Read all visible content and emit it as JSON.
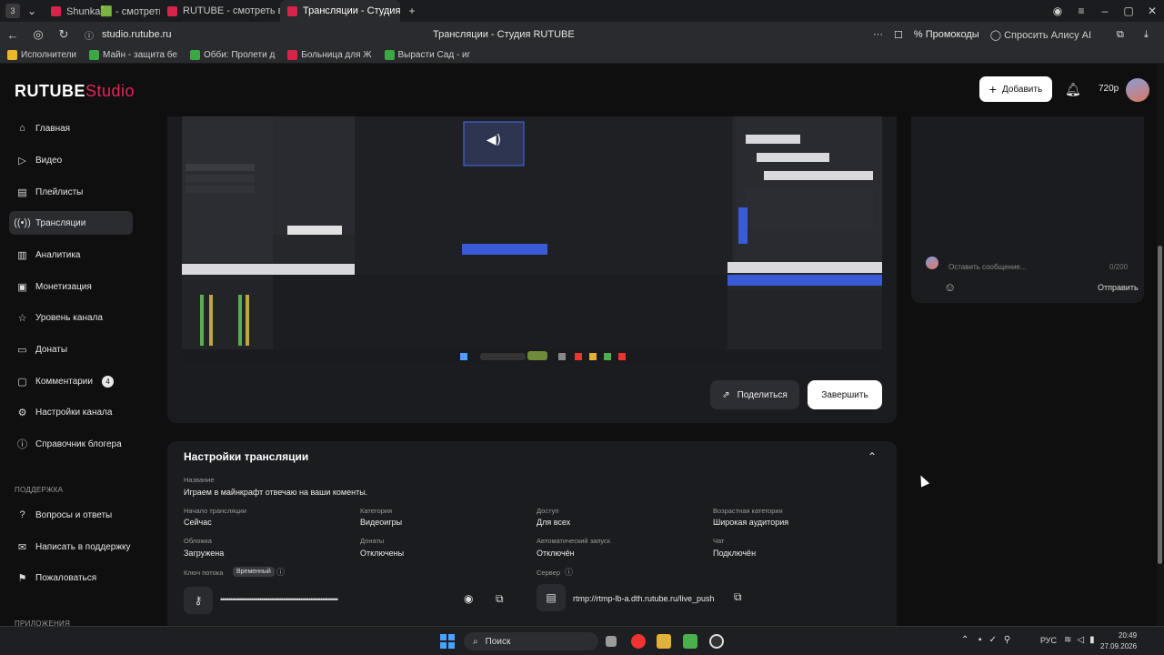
{
  "browser": {
    "tabs": [
      {
        "label": "Shunka🟩 - смотреть он",
        "fav": "rt"
      },
      {
        "label": "RUTUBE - смотреть виде",
        "fav": "rt"
      },
      {
        "label": "Трансляции - Студия R",
        "fav": "rt",
        "active": true
      }
    ],
    "url": "studio.rutube.ru",
    "page_title": "Трансляции - Студия RUTUBE",
    "promo_label": "Промокоды",
    "alice_label": "Спросить Алису AI",
    "bookmarks": [
      "Исполнители",
      "Майн - защита бе",
      "Обби: Пролети д",
      "Больница для Ж",
      "Вырасти Сад - иг"
    ]
  },
  "header": {
    "logo_main": "RUTUBE",
    "logo_suffix": "Studio",
    "add_label": "Добавить",
    "quality": "720p"
  },
  "sidebar": {
    "items": [
      {
        "label": "Главная",
        "icon": "home-icon"
      },
      {
        "label": "Видео",
        "icon": "video-icon"
      },
      {
        "label": "Плейлисты",
        "icon": "playlist-icon"
      },
      {
        "label": "Трансляции",
        "icon": "broadcast-icon",
        "active": true
      },
      {
        "label": "Аналитика",
        "icon": "chart-icon"
      },
      {
        "label": "Монетизация",
        "icon": "money-icon"
      },
      {
        "label": "Уровень канала",
        "icon": "star-icon"
      },
      {
        "label": "Донаты",
        "icon": "donate-icon"
      },
      {
        "label": "Комментарии",
        "icon": "comment-icon",
        "badge": "4"
      },
      {
        "label": "Настройки канала",
        "icon": "settings-icon"
      },
      {
        "label": "Справочник блогера",
        "icon": "info-icon"
      }
    ],
    "support_title": "ПОДДЕРЖКА",
    "support_items": [
      {
        "label": "Вопросы и ответы",
        "icon": "question-icon"
      },
      {
        "label": "Написать в поддержку",
        "icon": "mail-icon"
      },
      {
        "label": "Пожаловаться",
        "icon": "flag-icon"
      }
    ],
    "apps_title": "ПРИЛОЖЕНИЯ"
  },
  "player": {
    "share_label": "Поделиться",
    "finish_label": "Завершить"
  },
  "chat": {
    "placeholder": "Оставить сообщение...",
    "counter": "0/200",
    "send_label": "Отправить"
  },
  "settings": {
    "title": "Настройки трансляции",
    "name_label": "Название",
    "name_value": "Играем в майнкрафт отвечаю на ваши коменты.",
    "fields": [
      {
        "label": "Начало трансляции",
        "value": "Сейчас"
      },
      {
        "label": "Категория",
        "value": "Видеоигры"
      },
      {
        "label": "Доступ",
        "value": "Для всех"
      },
      {
        "label": "Возрастная категория",
        "value": "Широкая аудитория"
      },
      {
        "label": "Обложка",
        "value": "Загружена"
      },
      {
        "label": "Донаты",
        "value": "Отключены"
      },
      {
        "label": "Автоматический запуск",
        "value": "Отключён"
      },
      {
        "label": "Чат",
        "value": "Подключён"
      }
    ],
    "key_label": "Ключ потока",
    "key_badge": "Временный",
    "key_value": "••••••••••••••••••••••••••••••••••••••••••••••••••••••••••••",
    "server_label": "Сервер",
    "server_value": "rtmp://rtmp-lb-a.dth.rutube.ru/live_push"
  },
  "taskbar": {
    "search_label": "Поиск",
    "lang": "РУС",
    "time": "20:49",
    "date": "27.09.2026"
  },
  "colors": {
    "accent": "#e8245a",
    "panel": "#1b1c1f",
    "background": "#0f0f10"
  }
}
